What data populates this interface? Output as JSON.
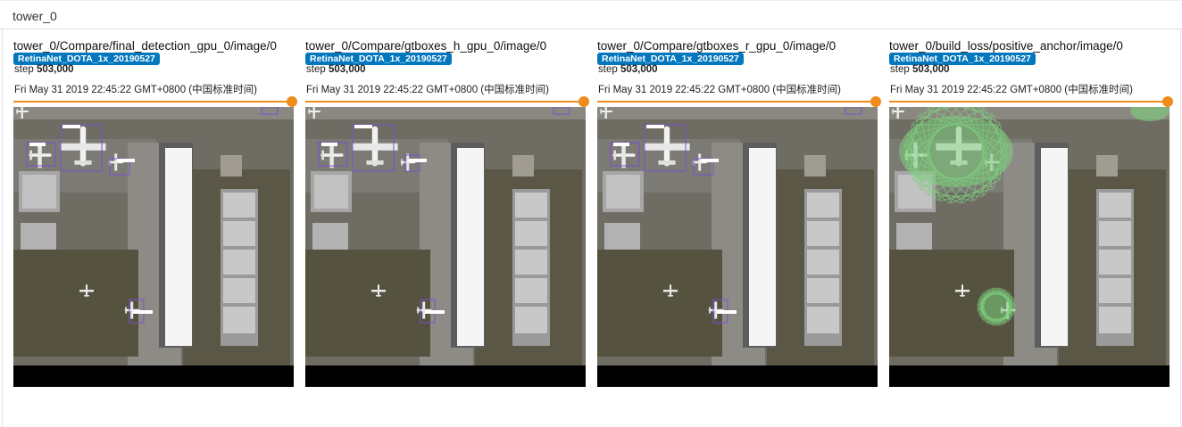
{
  "group": {
    "title": "tower_0"
  },
  "cards": [
    {
      "title": "tower_0/Compare/final_detection_gpu_0/image/0",
      "run": "RetinaNet_DOTA_1x_20190527",
      "step_label": "step",
      "step": "503,000",
      "timestamp": "Fri May 31 2019 22:45:22 GMT+0800 (中国标准时间)"
    },
    {
      "title": "tower_0/Compare/gtboxes_h_gpu_0/image/0",
      "run": "RetinaNet_DOTA_1x_20190527",
      "step_label": "step",
      "step": "503,000",
      "timestamp": "Fri May 31 2019 22:45:22 GMT+0800 (中国标准时间)"
    },
    {
      "title": "tower_0/Compare/gtboxes_r_gpu_0/image/0",
      "run": "RetinaNet_DOTA_1x_20190527",
      "step_label": "step",
      "step": "503,000",
      "timestamp": "Fri May 31 2019 22:45:22 GMT+0800 (中国标准时间)"
    },
    {
      "title": "tower_0/build_loss/positive_anchor/image/0",
      "run": "RetinaNet_DOTA_1x_20190527",
      "step_label": "step",
      "step": "503,000",
      "timestamp": "Fri May 31 2019 22:45:22 GMT+0800 (中国标准时间)"
    }
  ],
  "colors": {
    "accent": "#ef8c1b",
    "badge": "#0277bd",
    "box": "#7b4fcf",
    "anchor": "#7ed07e"
  }
}
